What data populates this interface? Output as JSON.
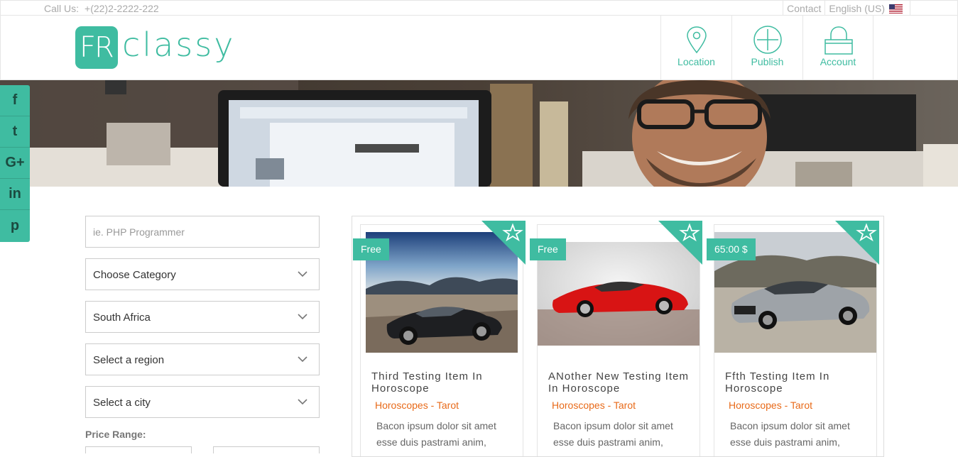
{
  "topbar": {
    "call_label": "Call Us:",
    "phone": "+(22)2-2222-222",
    "contact": "Contact",
    "language": "English (US)"
  },
  "logo": {
    "mark": "FR",
    "word": "classy"
  },
  "nav": [
    {
      "label": "Location",
      "icon": "location-pin-icon"
    },
    {
      "label": "Publish",
      "icon": "plus-circle-icon"
    },
    {
      "label": "Account",
      "icon": "lock-icon"
    }
  ],
  "social": [
    "facebook-icon",
    "twitter-icon",
    "google-plus-icon",
    "linkedin-icon",
    "pinterest-icon"
  ],
  "social_glyphs": [
    "f",
    "t",
    "G+",
    "in",
    "p"
  ],
  "filters": {
    "search_placeholder": "ie. PHP Programmer",
    "category": "Choose Category",
    "country": "South Africa",
    "region": "Select a region",
    "city": "Select a city",
    "price_label": "Price Range:"
  },
  "listings": [
    {
      "price": "Free",
      "title": "Third Testing Item In Horoscope",
      "category": "Horoscopes - Tarot",
      "desc": "Bacon ipsum dolor sit amet esse duis pastrami anim,"
    },
    {
      "price": "Free",
      "title": "ANother New Testing Item In Horoscope",
      "category": "Horoscopes - Tarot",
      "desc": "Bacon ipsum dolor sit amet esse duis pastrami anim,"
    },
    {
      "price": "65:00 $",
      "title": "Ffth Testing Item In Horoscope",
      "category": "Horoscopes - Tarot",
      "desc": "Bacon ipsum dolor sit amet esse duis pastrami anim,"
    }
  ],
  "colors": {
    "accent": "#3fbca1",
    "category": "#e86a19"
  }
}
